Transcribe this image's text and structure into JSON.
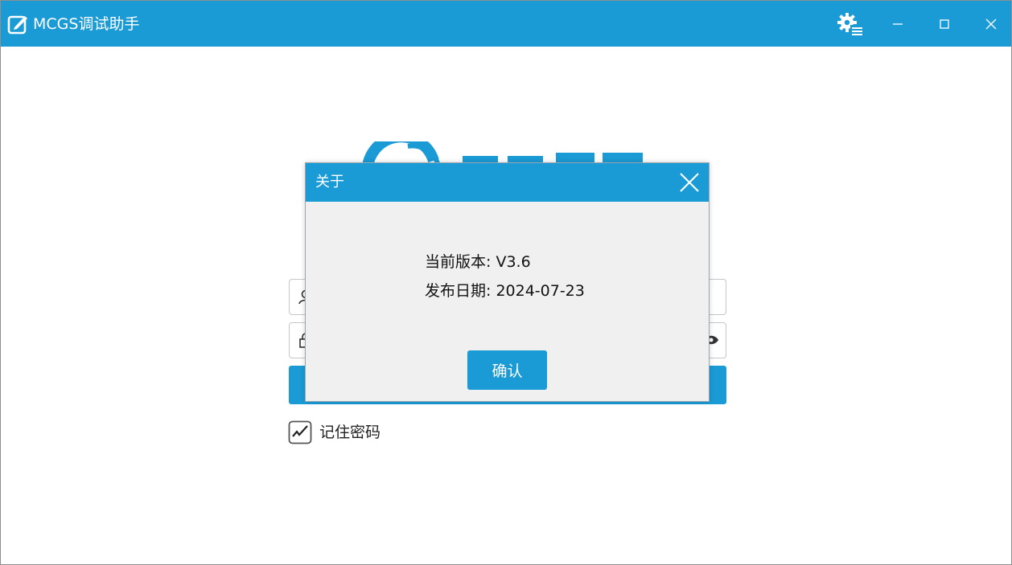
{
  "app": {
    "title": "MCGS调试助手",
    "accent_color": "#1a9bd6"
  },
  "titlebar": {
    "icons": [
      "edit-icon",
      "settings-menu-icon",
      "minimize-icon",
      "maximize-icon",
      "close-icon"
    ]
  },
  "login": {
    "remember_label": "记住密码",
    "remember_checked": true,
    "icons": [
      "user-icon",
      "lock-icon",
      "eye-icon"
    ]
  },
  "about_dialog": {
    "title": "关于",
    "version_line": "当前版本: V3.6",
    "date_line": "发布日期: 2024-07-23",
    "ok_label": "确认"
  }
}
